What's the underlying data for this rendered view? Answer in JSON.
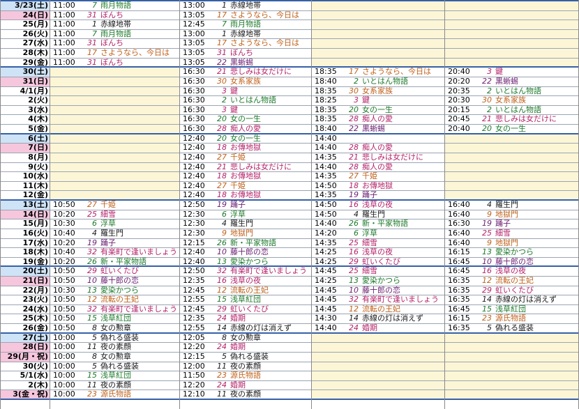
{
  "colors": {
    "saturday": "#cfe3f6",
    "sunday": "#f6c6dd",
    "empty": "#fcf6d6",
    "divider": "#3560a8"
  },
  "rows": [
    {
      "date": "3/23(土)",
      "day": "sat",
      "slots": [
        {
          "time": "11:00",
          "num": "7",
          "title": "雨月物語",
          "color": "#1d7a2a"
        },
        {
          "time": "13:00",
          "num": "1",
          "title": "赤線地帯",
          "color": "#1a1a1a"
        },
        null,
        null
      ]
    },
    {
      "date": "24(日)",
      "day": "sun",
      "slots": [
        {
          "time": "11:00",
          "num": "31",
          "title": "ぼんち",
          "color": "#b5236a"
        },
        {
          "time": "13:05",
          "num": "17",
          "title": "さようなら、今日は",
          "color": "#c0621b"
        },
        null,
        null
      ]
    },
    {
      "date": "25(月)",
      "day": "",
      "slots": [
        {
          "time": "11:00",
          "num": "1",
          "title": "赤線地帯",
          "color": "#1a1a1a"
        },
        {
          "time": "12:45",
          "num": "7",
          "title": "雨月物語",
          "color": "#1d7a2a"
        },
        null,
        null
      ]
    },
    {
      "date": "26(火)",
      "day": "",
      "slots": [
        {
          "time": "11:00",
          "num": "7",
          "title": "雨月物語",
          "color": "#1d7a2a"
        },
        {
          "time": "13:00",
          "num": "1",
          "title": "赤線地帯",
          "color": "#1a1a1a"
        },
        null,
        null
      ]
    },
    {
      "date": "27(水)",
      "day": "",
      "slots": [
        {
          "time": "11:00",
          "num": "31",
          "title": "ぼんち",
          "color": "#b5236a"
        },
        {
          "time": "13:05",
          "num": "17",
          "title": "さようなら、今日は",
          "color": "#c0621b"
        },
        null,
        null
      ]
    },
    {
      "date": "28(木)",
      "day": "",
      "slots": [
        {
          "time": "11:00",
          "num": "17",
          "title": "さようなら、今日は",
          "color": "#c0621b"
        },
        {
          "time": "13:05",
          "num": "31",
          "title": "ぼんち",
          "color": "#b5236a"
        },
        null,
        null
      ]
    },
    {
      "date": "29(金)",
      "day": "",
      "slots": [
        {
          "time": "11:00",
          "num": "31",
          "title": "ぼんち",
          "color": "#b5236a"
        },
        {
          "time": "13:05",
          "num": "22",
          "title": "黒蜥蜴",
          "color": "#6b1e72"
        },
        null,
        null
      ]
    },
    {
      "date": "30(土)",
      "day": "sat",
      "slots": [
        null,
        {
          "time": "16:30",
          "num": "21",
          "title": "悲しみは女だけに",
          "color": "#b5236a"
        },
        {
          "time": "18:35",
          "num": "17",
          "title": "さようなら、今日は",
          "color": "#c0621b"
        },
        {
          "time": "20:40",
          "num": "3",
          "title": "鍵",
          "color": "#b5236a"
        }
      ]
    },
    {
      "date": "31(日)",
      "day": "sun",
      "slots": [
        null,
        {
          "time": "16:30",
          "num": "30",
          "title": "女系家族",
          "color": "#c0621b"
        },
        {
          "time": "18:40",
          "num": "2",
          "title": "いとはん物語",
          "color": "#1d7a2a"
        },
        {
          "time": "20:20",
          "num": "22",
          "title": "黒蜥蜴",
          "color": "#6b1e72"
        }
      ]
    },
    {
      "date": "4/1(月)",
      "day": "",
      "slots": [
        null,
        {
          "time": "16:30",
          "num": "3",
          "title": "鍵",
          "color": "#b5236a"
        },
        {
          "time": "18:35",
          "num": "30",
          "title": "女系家族",
          "color": "#c0621b"
        },
        {
          "time": "20:35",
          "num": "2",
          "title": "いとはん物語",
          "color": "#1d7a2a"
        }
      ]
    },
    {
      "date": "2(火)",
      "day": "",
      "slots": [
        null,
        {
          "time": "16:30",
          "num": "2",
          "title": "いとはん物語",
          "color": "#1d7a2a"
        },
        {
          "time": "18:25",
          "num": "3",
          "title": "鍵",
          "color": "#b5236a"
        },
        {
          "time": "20:30",
          "num": "30",
          "title": "女系家族",
          "color": "#c0621b"
        }
      ]
    },
    {
      "date": "3(水)",
      "day": "",
      "slots": [
        null,
        {
          "time": "16:30",
          "num": "3",
          "title": "鍵",
          "color": "#b5236a"
        },
        {
          "time": "18:35",
          "num": "20",
          "title": "女の一生",
          "color": "#1d7a2a"
        },
        {
          "time": "20:15",
          "num": "2",
          "title": "いとはん物語",
          "color": "#1d7a2a"
        }
      ]
    },
    {
      "date": "4(木)",
      "day": "",
      "slots": [
        null,
        {
          "time": "16:30",
          "num": "20",
          "title": "女の一生",
          "color": "#1d7a2a"
        },
        {
          "time": "18:35",
          "num": "28",
          "title": "痴人の愛",
          "color": "#b5236a"
        },
        {
          "time": "20:45",
          "num": "21",
          "title": "悲しみは女だけに",
          "color": "#b5236a"
        }
      ]
    },
    {
      "date": "5(金)",
      "day": "",
      "slots": [
        null,
        {
          "time": "16:30",
          "num": "28",
          "title": "痴人の愛",
          "color": "#b5236a"
        },
        {
          "time": "18:40",
          "num": "22",
          "title": "黒蜥蜴",
          "color": "#6b1e72"
        },
        {
          "time": "20:40",
          "num": "20",
          "title": "女の一生",
          "color": "#1d7a2a"
        }
      ]
    },
    {
      "date": "6(土)",
      "day": "sat",
      "slots": [
        null,
        {
          "time": "12:40",
          "num": "20",
          "title": "女の一生",
          "color": "#1d7a2a"
        },
        {
          "time": "14:40",
          "num": "",
          "title": "",
          "color": "#1a1a1a"
        },
        null
      ]
    },
    {
      "date": "7(日)",
      "day": "sun",
      "slots": [
        null,
        {
          "time": "12:40",
          "num": "18",
          "title": "お傳地獄",
          "color": "#b5236a"
        },
        {
          "time": "14:40",
          "num": "28",
          "title": "痴人の愛",
          "color": "#b5236a"
        },
        null
      ]
    },
    {
      "date": "8(月)",
      "day": "",
      "slots": [
        null,
        {
          "time": "12:40",
          "num": "27",
          "title": "千姫",
          "color": "#c0621b"
        },
        {
          "time": "14:35",
          "num": "21",
          "title": "悲しみは女だけに",
          "color": "#b5236a"
        },
        null
      ]
    },
    {
      "date": "9(火)",
      "day": "",
      "slots": [
        null,
        {
          "time": "12:40",
          "num": "21",
          "title": "悲しみは女だけに",
          "color": "#b5236a"
        },
        {
          "time": "14:40",
          "num": "28",
          "title": "痴人の愛",
          "color": "#b5236a"
        },
        null
      ]
    },
    {
      "date": "10(水)",
      "day": "",
      "slots": [
        null,
        {
          "time": "12:40",
          "num": "18",
          "title": "お傳地獄",
          "color": "#b5236a"
        },
        {
          "time": "14:35",
          "num": "27",
          "title": "千姫",
          "color": "#c0621b"
        },
        null
      ]
    },
    {
      "date": "11(木)",
      "day": "",
      "slots": [
        null,
        {
          "time": "12:40",
          "num": "27",
          "title": "千姫",
          "color": "#c0621b"
        },
        {
          "time": "14:50",
          "num": "18",
          "title": "お傳地獄",
          "color": "#b5236a"
        },
        null
      ]
    },
    {
      "date": "12(金)",
      "day": "",
      "slots": [
        null,
        {
          "time": "12:40",
          "num": "18",
          "title": "お傳地獄",
          "color": "#b5236a"
        },
        {
          "time": "14:35",
          "num": "19",
          "title": "踊子",
          "color": "#6b1e72"
        },
        null
      ]
    },
    {
      "date": "13(土)",
      "day": "sat",
      "slots": [
        {
          "time": "10:50",
          "num": "27",
          "title": "千姫",
          "color": "#c0621b"
        },
        {
          "time": "12:50",
          "num": "19",
          "title": "踊子",
          "color": "#6b1e72"
        },
        {
          "time": "14:50",
          "num": "16",
          "title": "浅草の夜",
          "color": "#b5236a"
        },
        {
          "time": "16:40",
          "num": "4",
          "title": "羅生門",
          "color": "#1a1a1a"
        }
      ]
    },
    {
      "date": "14(日)",
      "day": "sun",
      "slots": [
        {
          "time": "10:20",
          "num": "25",
          "title": "細雪",
          "color": "#b5236a"
        },
        {
          "time": "12:30",
          "num": "6",
          "title": "浮草",
          "color": "#1d7a2a"
        },
        {
          "time": "14:50",
          "num": "4",
          "title": "羅生門",
          "color": "#1a1a1a"
        },
        {
          "time": "16:40",
          "num": "9",
          "title": "地獄門",
          "color": "#c0621b"
        }
      ]
    },
    {
      "date": "15(月)",
      "day": "",
      "slots": [
        {
          "time": "10:30",
          "num": "6",
          "title": "浮草",
          "color": "#1d7a2a"
        },
        {
          "time": "12:30",
          "num": "4",
          "title": "羅生門",
          "color": "#1a1a1a"
        },
        {
          "time": "14:40",
          "num": "26",
          "title": "新・平家物語",
          "color": "#1d7a2a"
        },
        {
          "time": "16:30",
          "num": "19",
          "title": "踊子",
          "color": "#6b1e72"
        }
      ]
    },
    {
      "date": "16(火)",
      "day": "",
      "slots": [
        {
          "time": "10:40",
          "num": "4",
          "title": "羅生門",
          "color": "#1a1a1a"
        },
        {
          "time": "12:30",
          "num": "9",
          "title": "地獄門",
          "color": "#c0621b"
        },
        {
          "time": "14:20",
          "num": "6",
          "title": "浮草",
          "color": "#1d7a2a"
        },
        {
          "time": "16:40",
          "num": "25",
          "title": "細雪",
          "color": "#b5236a"
        }
      ]
    },
    {
      "date": "17(水)",
      "day": "",
      "slots": [
        {
          "time": "10:20",
          "num": "19",
          "title": "踊子",
          "color": "#6b1e72"
        },
        {
          "time": "12:15",
          "num": "26",
          "title": "新・平家物語",
          "color": "#1d7a2a"
        },
        {
          "time": "14:35",
          "num": "25",
          "title": "細雪",
          "color": "#b5236a"
        },
        {
          "time": "16:40",
          "num": "9",
          "title": "地獄門",
          "color": "#c0621b"
        }
      ]
    },
    {
      "date": "18(木)",
      "day": "",
      "slots": [
        {
          "time": "10:40",
          "num": "32",
          "title": "有楽町で逢いましょう",
          "color": "#b5236a"
        },
        {
          "time": "12:40",
          "num": "10",
          "title": "藤十郎の恋",
          "color": "#6b1e72"
        },
        {
          "time": "14:25",
          "num": "16",
          "title": "浅草の夜",
          "color": "#b5236a"
        },
        {
          "time": "16:15",
          "num": "13",
          "title": "愛染かつら",
          "color": "#1d7a2a"
        }
      ]
    },
    {
      "date": "19(金)",
      "day": "",
      "slots": [
        {
          "time": "10:20",
          "num": "26",
          "title": "新・平家物語",
          "color": "#1d7a2a"
        },
        {
          "time": "12:40",
          "num": "13",
          "title": "愛染かつら",
          "color": "#1d7a2a"
        },
        {
          "time": "14:25",
          "num": "29",
          "title": "虹いくたび",
          "color": "#b5236a"
        },
        {
          "time": "16:45",
          "num": "10",
          "title": "藤十郎の恋",
          "color": "#6b1e72"
        }
      ]
    },
    {
      "date": "20(土)",
      "day": "sat",
      "slots": [
        {
          "time": "10:50",
          "num": "29",
          "title": "虹いくたび",
          "color": "#b5236a"
        },
        {
          "time": "12:50",
          "num": "32",
          "title": "有楽町で逢いましょう",
          "color": "#b5236a"
        },
        {
          "time": "14:45",
          "num": "25",
          "title": "細雪",
          "color": "#b5236a"
        },
        {
          "time": "16:45",
          "num": "16",
          "title": "浅草の夜",
          "color": "#b5236a"
        }
      ]
    },
    {
      "date": "21(日)",
      "day": "sun",
      "slots": [
        {
          "time": "10:50",
          "num": "10",
          "title": "藤十郎の恋",
          "color": "#6b1e72"
        },
        {
          "time": "12:35",
          "num": "16",
          "title": "浅草の夜",
          "color": "#b5236a"
        },
        {
          "time": "14:25",
          "num": "13",
          "title": "愛染かつら",
          "color": "#1d7a2a"
        },
        {
          "time": "16:35",
          "num": "12",
          "title": "流転の王妃",
          "color": "#c0621b"
        }
      ]
    },
    {
      "date": "22(月)",
      "day": "",
      "slots": [
        {
          "time": "10:30",
          "num": "13",
          "title": "愛染かつら",
          "color": "#1d7a2a"
        },
        {
          "time": "12:45",
          "num": "12",
          "title": "流転の王妃",
          "color": "#c0621b"
        },
        {
          "time": "14:45",
          "num": "10",
          "title": "藤十郎の恋",
          "color": "#6b1e72"
        },
        {
          "time": "16:35",
          "num": "29",
          "title": "虹いくたび",
          "color": "#b5236a"
        }
      ]
    },
    {
      "date": "23(火)",
      "day": "",
      "slots": [
        {
          "time": "10:50",
          "num": "12",
          "title": "流転の王妃",
          "color": "#c0621b"
        },
        {
          "time": "12:55",
          "num": "15",
          "title": "浅草紅団",
          "color": "#1d7a2a"
        },
        {
          "time": "14:45",
          "num": "32",
          "title": "有楽町で逢いましょう",
          "color": "#b5236a"
        },
        {
          "time": "16:35",
          "num": "14",
          "title": "赤線の灯は消えず",
          "color": "#1a1a1a"
        }
      ]
    },
    {
      "date": "24(水)",
      "day": "",
      "slots": [
        {
          "time": "10:50",
          "num": "32",
          "title": "有楽町で逢いましょう",
          "color": "#b5236a"
        },
        {
          "time": "12:45",
          "num": "29",
          "title": "虹いくたび",
          "color": "#b5236a"
        },
        {
          "time": "14:45",
          "num": "12",
          "title": "流転の王妃",
          "color": "#c0621b"
        },
        {
          "time": "16:45",
          "num": "15",
          "title": "浅草紅団",
          "color": "#1d7a2a"
        }
      ]
    },
    {
      "date": "25(木)",
      "day": "",
      "slots": [
        {
          "time": "10:50",
          "num": "15",
          "title": "浅草紅団",
          "color": "#1d7a2a"
        },
        {
          "time": "12:35",
          "num": "24",
          "title": "婚期",
          "color": "#b5236a"
        },
        {
          "time": "14:30",
          "num": "14",
          "title": "赤線の灯は消えず",
          "color": "#1a1a1a"
        },
        {
          "time": "16:15",
          "num": "23",
          "title": "源氏物語",
          "color": "#c0621b"
        }
      ]
    },
    {
      "date": "26(金)",
      "day": "",
      "slots": [
        {
          "time": "10:50",
          "num": "8",
          "title": "女の勲章",
          "color": "#1a1a1a"
        },
        {
          "time": "12:55",
          "num": "14",
          "title": "赤線の灯は消えず",
          "color": "#1a1a1a"
        },
        {
          "time": "14:40",
          "num": "24",
          "title": "婚期",
          "color": "#b5236a"
        },
        {
          "time": "16:35",
          "num": "5",
          "title": "偽れる盛装",
          "color": "#1a1a1a"
        }
      ]
    },
    {
      "date": "27(土)",
      "day": "sat",
      "slots": [
        {
          "time": "10:00",
          "num": "5",
          "title": "偽れる盛装",
          "color": "#1a1a1a"
        },
        {
          "time": "12:05",
          "num": "8",
          "title": "女の勲章",
          "color": "#1a1a1a"
        },
        null,
        null
      ]
    },
    {
      "date": "28(日)",
      "day": "sun",
      "slots": [
        {
          "time": "10:00",
          "num": "11",
          "title": "夜の素顔",
          "color": "#1a1a1a"
        },
        {
          "time": "12:20",
          "num": "24",
          "title": "婚期",
          "color": "#b5236a"
        },
        null,
        null
      ]
    },
    {
      "date": "29(月・祝)",
      "day": "sun",
      "slots": [
        {
          "time": "10:00",
          "num": "8",
          "title": "女の勲章",
          "color": "#1a1a1a"
        },
        {
          "time": "12:15",
          "num": "5",
          "title": "偽れる盛装",
          "color": "#1a1a1a"
        },
        null,
        null
      ]
    },
    {
      "date": "30(火)",
      "day": "",
      "slots": [
        {
          "time": "10:00",
          "num": "5",
          "title": "偽れる盛装",
          "color": "#1a1a1a"
        },
        {
          "time": "12:00",
          "num": "11",
          "title": "夜の素顔",
          "color": "#1a1a1a"
        },
        null,
        null
      ]
    },
    {
      "date": "5/1(水)",
      "day": "",
      "slots": [
        {
          "time": "10:00",
          "num": "15",
          "title": "浅草紅団",
          "color": "#1d7a2a"
        },
        {
          "time": "11:50",
          "num": "23",
          "title": "源氏物語",
          "color": "#c0621b"
        },
        null,
        null
      ]
    },
    {
      "date": "2(木)",
      "day": "",
      "slots": [
        {
          "time": "10:00",
          "num": "11",
          "title": "夜の素顔",
          "color": "#1a1a1a"
        },
        {
          "time": "12:20",
          "num": "24",
          "title": "婚期",
          "color": "#b5236a"
        },
        null,
        null
      ]
    },
    {
      "date": "3(金・祝)",
      "day": "sun",
      "slots": [
        {
          "time": "10:00",
          "num": "23",
          "title": "源氏物語",
          "color": "#c0621b"
        },
        {
          "time": "12:10",
          "num": "11",
          "title": "夜の素顔",
          "color": "#1a1a1a"
        },
        null,
        null
      ]
    }
  ]
}
